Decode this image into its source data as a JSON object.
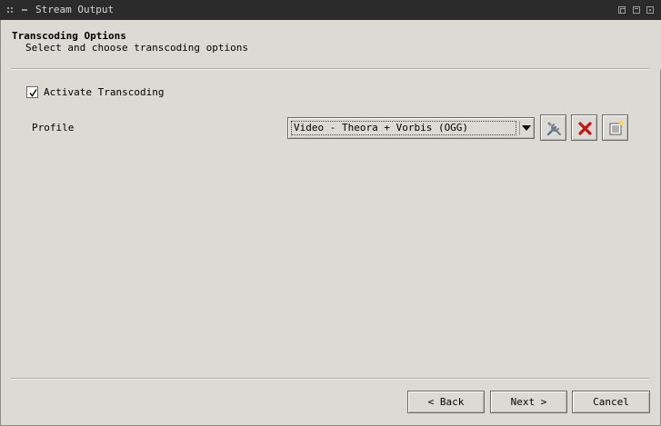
{
  "window": {
    "title": "Stream Output"
  },
  "header": {
    "title": "Transcoding Options",
    "subtitle": "Select and choose transcoding options"
  },
  "transcoding": {
    "activate_label": "Activate Transcoding",
    "activate_checked": true
  },
  "profile": {
    "label": "Profile",
    "selected": "Video - Theora + Vorbis (OGG)"
  },
  "icons": {
    "edit": "tools-icon",
    "delete": "delete-x-icon",
    "new": "new-profile-icon"
  },
  "colors": {
    "delete_red": "#cc1111",
    "background": "#dcdad5",
    "titlebar": "#2b2b2b"
  },
  "footer": {
    "back_label": "< Back",
    "next_label": "Next >",
    "cancel_label": "Cancel"
  }
}
